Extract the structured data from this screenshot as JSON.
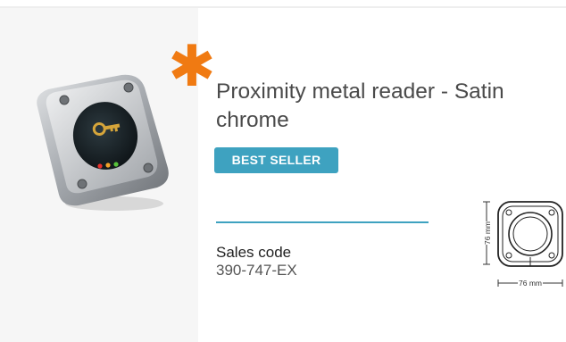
{
  "product": {
    "title": "Proximity metal reader - Satin chrome",
    "badge": "BEST SELLER",
    "sales_code_label": "Sales code",
    "sales_code_value": "390-747-EX"
  },
  "diagram": {
    "height_label": "76 mm",
    "width_label": "76 mm"
  },
  "colors": {
    "accent": "#3ea2c0",
    "asterisk": "#f07a12",
    "led_colors": [
      "#e9302b",
      "#f2a22a",
      "#57c23a"
    ]
  },
  "icons": {
    "asterisk": "asterisk-icon"
  }
}
